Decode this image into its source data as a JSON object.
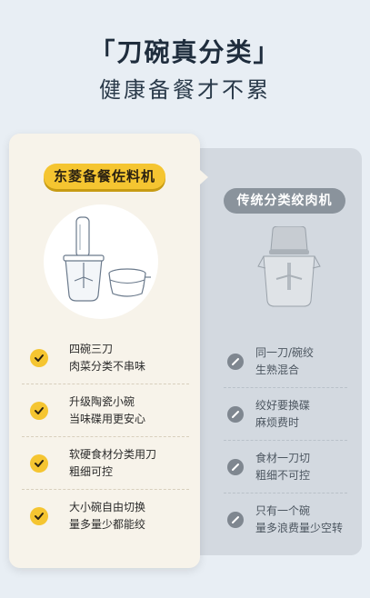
{
  "headline": {
    "title": "「刀碗真分类」",
    "subtitle": "健康备餐才不累"
  },
  "left_card": {
    "badge": "东菱备餐佐料机",
    "image": "chopper-with-bowls-image",
    "features": [
      {
        "line1": "四碗三刀",
        "line2": "肉菜分类不串味"
      },
      {
        "line1": "升级陶瓷小碗",
        "line2": "当味碟用更安心"
      },
      {
        "line1": "软硬食材分类用刀",
        "line2": "粗细可控"
      },
      {
        "line1": "大小碗自由切换",
        "line2": "量多量少都能绞"
      }
    ],
    "icon": "check-icon"
  },
  "right_card": {
    "badge": "传统分类绞肉机",
    "image": "traditional-grinder-image",
    "features": [
      {
        "line1": "同一刀/碗绞",
        "line2": "生熟混合"
      },
      {
        "line1": "绞好要换碟",
        "line2": "麻烦费时"
      },
      {
        "line1": "食材一刀切",
        "line2": "粗细不可控"
      },
      {
        "line1": "只有一个碗",
        "line2": "量多浪费量少空转"
      }
    ],
    "icon": "slash-circle-icon"
  },
  "colors": {
    "background": "#e8eef4",
    "accent_yellow": "#f5c531",
    "gray_badge": "#8a939c",
    "left_card": "#f7f3ea",
    "right_card": "#d3d9e0"
  }
}
